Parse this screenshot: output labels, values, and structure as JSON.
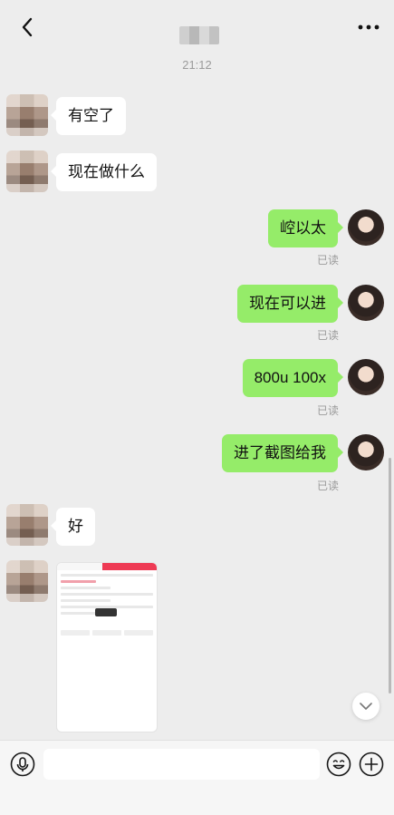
{
  "header": {
    "back_icon": "chevron-left-icon",
    "more_icon": "more-dots-icon"
  },
  "timestamp": "21:12",
  "messages": [
    {
      "side": "in",
      "text": "有空了"
    },
    {
      "side": "in",
      "text": "现在做什么"
    },
    {
      "side": "out",
      "text": "崆以太",
      "status": "已读"
    },
    {
      "side": "out",
      "text": "现在可以进",
      "status": "已读"
    },
    {
      "side": "out",
      "text": "800u 100x",
      "status": "已读"
    },
    {
      "side": "out",
      "text": "进了截图给我",
      "status": "已读"
    },
    {
      "side": "in",
      "text": "好"
    },
    {
      "side": "in",
      "type": "image"
    }
  ],
  "input": {
    "value": "",
    "voice_icon": "microphone-icon",
    "emoji_icon": "emoji-icon",
    "plus_icon": "plus-icon"
  },
  "colors": {
    "background": "#ededed",
    "outgoing_bubble": "#95ec69",
    "incoming_bubble": "#ffffff"
  }
}
